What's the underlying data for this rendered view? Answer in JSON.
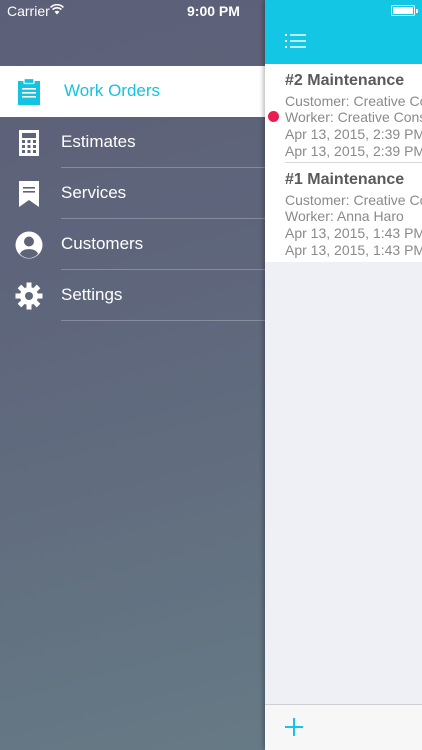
{
  "status_bar": {
    "carrier": "Carrier",
    "time": "9:00 PM"
  },
  "menu": {
    "items": [
      {
        "label": "Work Orders",
        "icon": "clipboard-icon",
        "active": true
      },
      {
        "label": "Estimates",
        "icon": "calculator-icon"
      },
      {
        "label": "Services",
        "icon": "bookmark-icon"
      },
      {
        "label": "Customers",
        "icon": "person-icon"
      },
      {
        "label": "Settings",
        "icon": "gear-icon"
      }
    ]
  },
  "work_orders": [
    {
      "title": "#2 Maintenance",
      "customer": "Customer: Creative Co",
      "worker": "Worker: Creative Cons",
      "created": "Apr 13, 2015, 2:39 PM",
      "updated": "Apr 13, 2015, 2:39 PM",
      "unread": true
    },
    {
      "title": "#1 Maintenance",
      "customer": "Customer: Creative Co",
      "worker": "Worker: Anna Haro",
      "created": "Apr 13, 2015, 1:43 PM",
      "updated": "Apr 13, 2015, 1:43 PM",
      "unread": false
    }
  ],
  "colors": {
    "accent": "#13c6e3",
    "unread": "#ea1d4f"
  }
}
